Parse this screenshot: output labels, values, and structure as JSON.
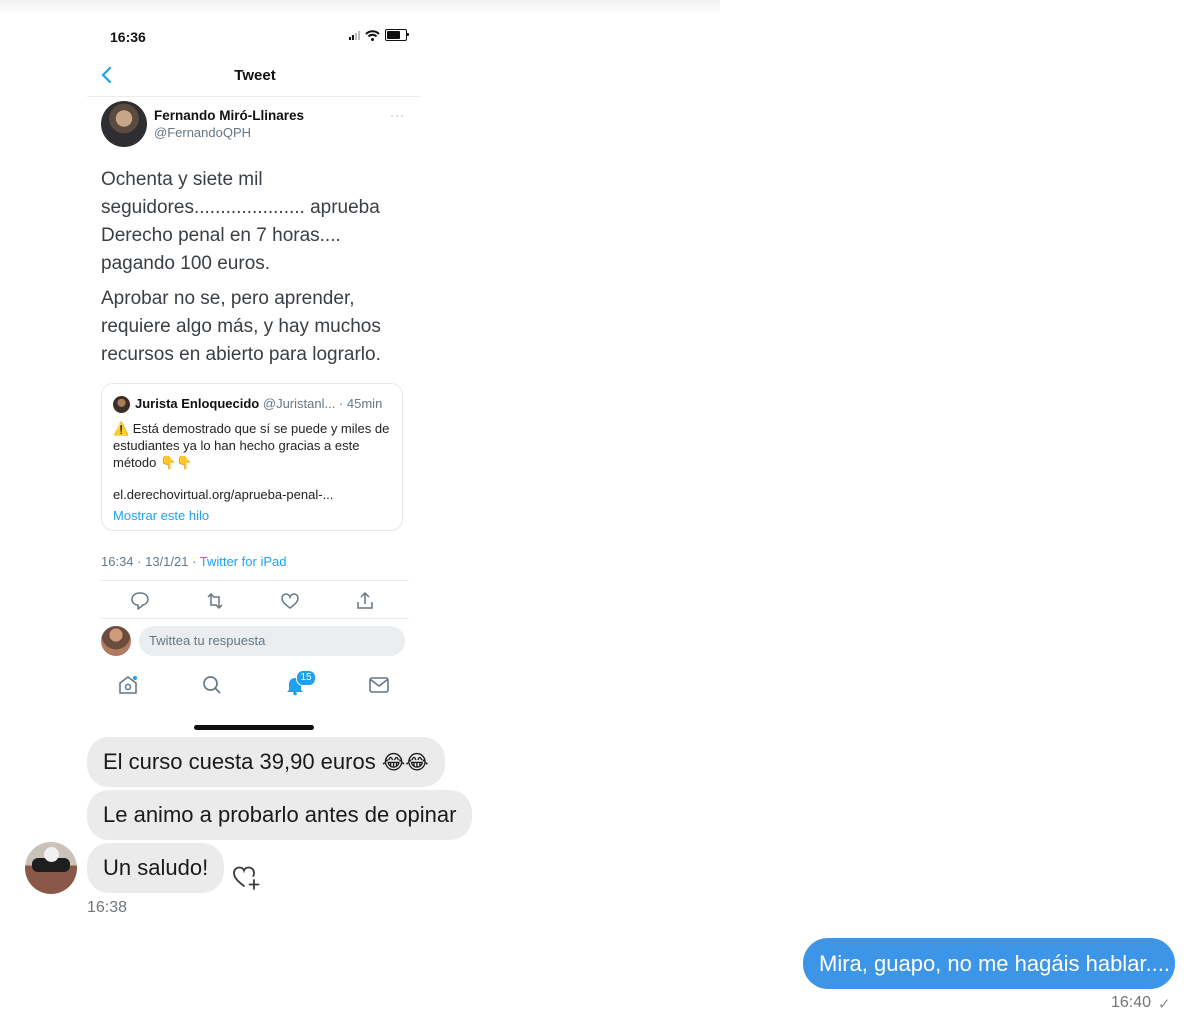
{
  "phone": {
    "status_time": "16:36",
    "nav_title": "Tweet",
    "tweet": {
      "author_name": "Fernando Miró-Llinares",
      "author_handle": "@FernandoQPH",
      "more": "···",
      "paragraphs": [
        "Ochenta y siete mil\nseguidores..................... aprueba\nDerecho penal en 7 horas....\npagando 100 euros.",
        "Aprobar no se, pero aprender,\nrequiere algo más, y hay muchos\nrecursos en abierto para lograrlo."
      ],
      "quoted": {
        "name": "Jurista Enloquecido",
        "handle": "@Juristanl...",
        "time": "· 45min",
        "text": "⚠️ Está demostrado que sí se puede y miles de estudiantes ya lo han hecho gracias a este método 👇👇",
        "link": "el.derechovirtual.org/aprueba-penal-...",
        "thread_label": "Mostrar este hilo"
      },
      "timestamp": "16:34 · 13/1/21 · ",
      "source": "Twitter for iPad"
    },
    "reply_placeholder": "Twittea tu respuesta",
    "notification_count": "15",
    "icons": [
      "back-chevron-icon",
      "reply-icon",
      "retweet-icon",
      "like-icon",
      "share-icon",
      "home-icon",
      "search-icon",
      "notifications-icon",
      "messages-icon"
    ]
  },
  "chat": {
    "incoming": [
      {
        "text": "El curso cuesta 39,90 euros ",
        "emoji": "😂😂"
      },
      {
        "text": "Le animo a probarlo antes de opinar"
      },
      {
        "text": "Un saludo!"
      }
    ],
    "incoming_time": "16:38",
    "outgoing": {
      "text": "Mira, guapo, no me hagáis hablar....",
      "time": "16:40",
      "status": "✓"
    },
    "colors": {
      "incoming_bubble": "#ebebeb",
      "outgoing_bubble": "#3d95e8",
      "twitter_blue": "#1da1f2"
    }
  }
}
